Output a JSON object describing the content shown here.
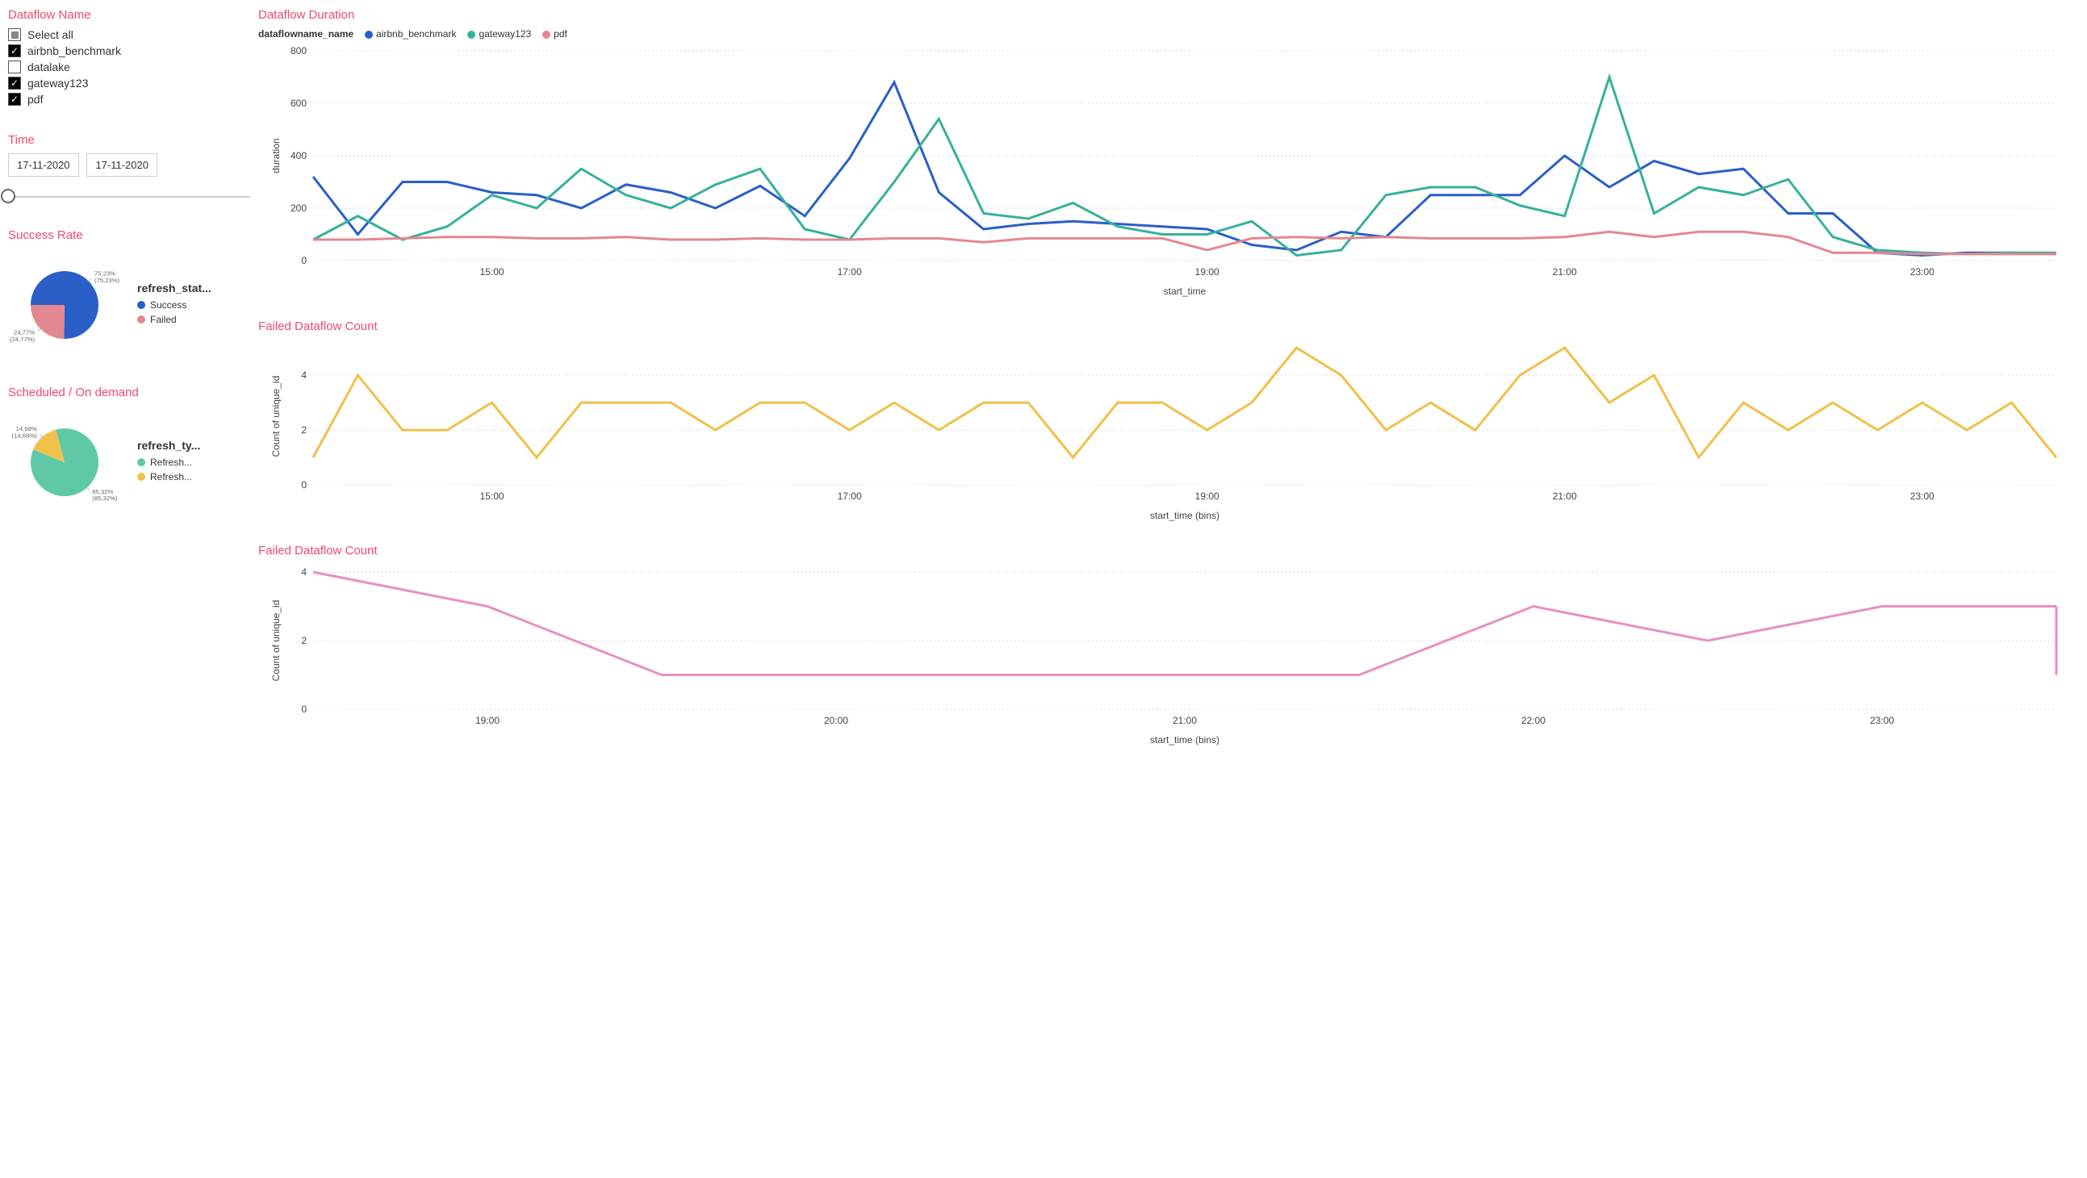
{
  "sidebar": {
    "dataflow_name": {
      "title": "Dataflow Name",
      "options": [
        {
          "label": "Select all",
          "state": "indeterminate"
        },
        {
          "label": "airbnb_benchmark",
          "state": "checked"
        },
        {
          "label": "datalake",
          "state": "unchecked"
        },
        {
          "label": "gateway123",
          "state": "checked"
        },
        {
          "label": "pdf",
          "state": "checked"
        }
      ]
    },
    "time": {
      "title": "Time",
      "from": "17-11-2020",
      "to": "17-11-2020"
    },
    "success_rate": {
      "title": "Success Rate",
      "legend_title": "refresh_stat...",
      "items": [
        {
          "label": "Success",
          "color": "#2a5fc7",
          "value": 75.23,
          "label_text_top": "75,23%",
          "label_text_bottom": "(75,23%)"
        },
        {
          "label": "Failed",
          "color": "#e38791",
          "value": 24.77,
          "label_text_top": "24,77%",
          "label_text_bottom": "(24,77%)"
        }
      ]
    },
    "scheduled_ondemand": {
      "title": "Scheduled / On demand",
      "legend_title": "refresh_ty...",
      "items": [
        {
          "label": "Refresh...",
          "color": "#5fc9a7",
          "value": 85.32,
          "label_text_top": "85,32%",
          "label_text_bottom": "(85,32%)"
        },
        {
          "label": "Refresh...",
          "color": "#f2c14b",
          "value": 14.68,
          "label_text_top": "14,68%",
          "label_text_bottom": "(14,68%)"
        }
      ]
    }
  },
  "chart_data": [
    {
      "id": "duration",
      "title": "Dataflow Duration",
      "type": "line",
      "legend_prefix": "dataflowname_name",
      "xlabel": "start_time",
      "ylabel": "duration",
      "ylim": [
        0,
        800
      ],
      "yticks": [
        0,
        200,
        400,
        600,
        800
      ],
      "xticks": [
        "15:00",
        "17:00",
        "19:00",
        "21:00",
        "23:00"
      ],
      "x": [
        "14:00",
        "14:15",
        "14:30",
        "14:45",
        "15:00",
        "15:15",
        "15:30",
        "15:45",
        "16:00",
        "16:15",
        "16:30",
        "16:45",
        "17:00",
        "17:15",
        "17:30",
        "17:45",
        "18:00",
        "18:15",
        "18:30",
        "18:45",
        "19:00",
        "19:15",
        "19:30",
        "19:45",
        "20:00",
        "20:15",
        "20:30",
        "20:45",
        "21:00",
        "21:15",
        "21:30",
        "21:45",
        "22:00",
        "22:15",
        "22:30",
        "22:45",
        "23:00",
        "23:15",
        "23:30",
        "23:45"
      ],
      "series": [
        {
          "name": "airbnb_benchmark",
          "color": "#2a5fc7",
          "values": [
            320,
            100,
            300,
            300,
            260,
            250,
            200,
            290,
            260,
            200,
            285,
            170,
            390,
            680,
            260,
            120,
            140,
            150,
            140,
            130,
            120,
            60,
            40,
            110,
            90,
            250,
            250,
            250,
            400,
            280,
            380,
            330,
            350,
            180,
            180,
            30,
            20,
            30,
            30,
            25
          ]
        },
        {
          "name": "gateway123",
          "color": "#37b09a",
          "values": [
            80,
            170,
            80,
            130,
            250,
            200,
            350,
            250,
            200,
            290,
            350,
            120,
            80,
            300,
            540,
            180,
            160,
            220,
            130,
            100,
            100,
            150,
            20,
            40,
            250,
            280,
            280,
            210,
            170,
            700,
            180,
            280,
            250,
            310,
            90,
            40,
            30,
            25,
            30,
            30
          ]
        },
        {
          "name": "pdf",
          "color": "#e38791",
          "values": [
            80,
            80,
            85,
            90,
            90,
            85,
            85,
            90,
            80,
            80,
            85,
            80,
            80,
            85,
            85,
            70,
            85,
            85,
            85,
            85,
            40,
            85,
            90,
            85,
            90,
            85,
            85,
            85,
            90,
            110,
            90,
            110,
            110,
            90,
            30,
            30,
            25,
            25,
            25,
            25
          ]
        }
      ]
    },
    {
      "id": "failed1",
      "title": "Failed Dataflow Count",
      "type": "line",
      "xlabel": "start_time (bins)",
      "ylabel": "Count of unique_id",
      "ylim": [
        0,
        5
      ],
      "yticks": [
        0,
        2,
        4
      ],
      "xticks": [
        "15:00",
        "17:00",
        "19:00",
        "21:00",
        "23:00"
      ],
      "x": [
        "14:00",
        "14:15",
        "14:30",
        "14:45",
        "15:00",
        "15:15",
        "15:30",
        "15:45",
        "16:00",
        "16:15",
        "16:30",
        "16:45",
        "17:00",
        "17:15",
        "17:30",
        "17:45",
        "18:00",
        "18:15",
        "18:30",
        "18:45",
        "19:00",
        "19:15",
        "19:30",
        "19:45",
        "20:00",
        "20:15",
        "20:30",
        "20:45",
        "21:00",
        "21:15",
        "21:30",
        "21:45",
        "22:00",
        "22:15",
        "22:30",
        "22:45",
        "23:00",
        "23:15",
        "23:30",
        "23:45"
      ],
      "series": [
        {
          "name": "failed",
          "color": "#efc04b",
          "values": [
            1,
            4,
            2,
            2,
            3,
            1,
            3,
            3,
            3,
            2,
            3,
            3,
            2,
            3,
            2,
            3,
            3,
            1,
            3,
            3,
            2,
            3,
            5,
            4,
            2,
            3,
            2,
            4,
            5,
            3,
            4,
            1,
            3,
            2,
            3,
            2,
            3,
            2,
            3,
            1
          ]
        }
      ]
    },
    {
      "id": "failed2",
      "title": "Failed Dataflow Count",
      "type": "line",
      "xlabel": "start_time (bins)",
      "ylabel": "Count of unique_id",
      "ylim": [
        0,
        4
      ],
      "yticks": [
        0,
        2,
        4
      ],
      "xticks": [
        "19:00",
        "20:00",
        "21:00",
        "22:00",
        "23:00"
      ],
      "x": [
        "18:30",
        "19:00",
        "19:30",
        "20:00",
        "20:30",
        "21:00",
        "21:30",
        "22:00",
        "22:30",
        "23:00",
        "23:30"
      ],
      "series": [
        {
          "name": "failed2",
          "color": "#e88fc1",
          "values": [
            4,
            3,
            1,
            1,
            1,
            1,
            1,
            3,
            2,
            3,
            3
          ]
        }
      ],
      "post_tail": 1
    }
  ]
}
